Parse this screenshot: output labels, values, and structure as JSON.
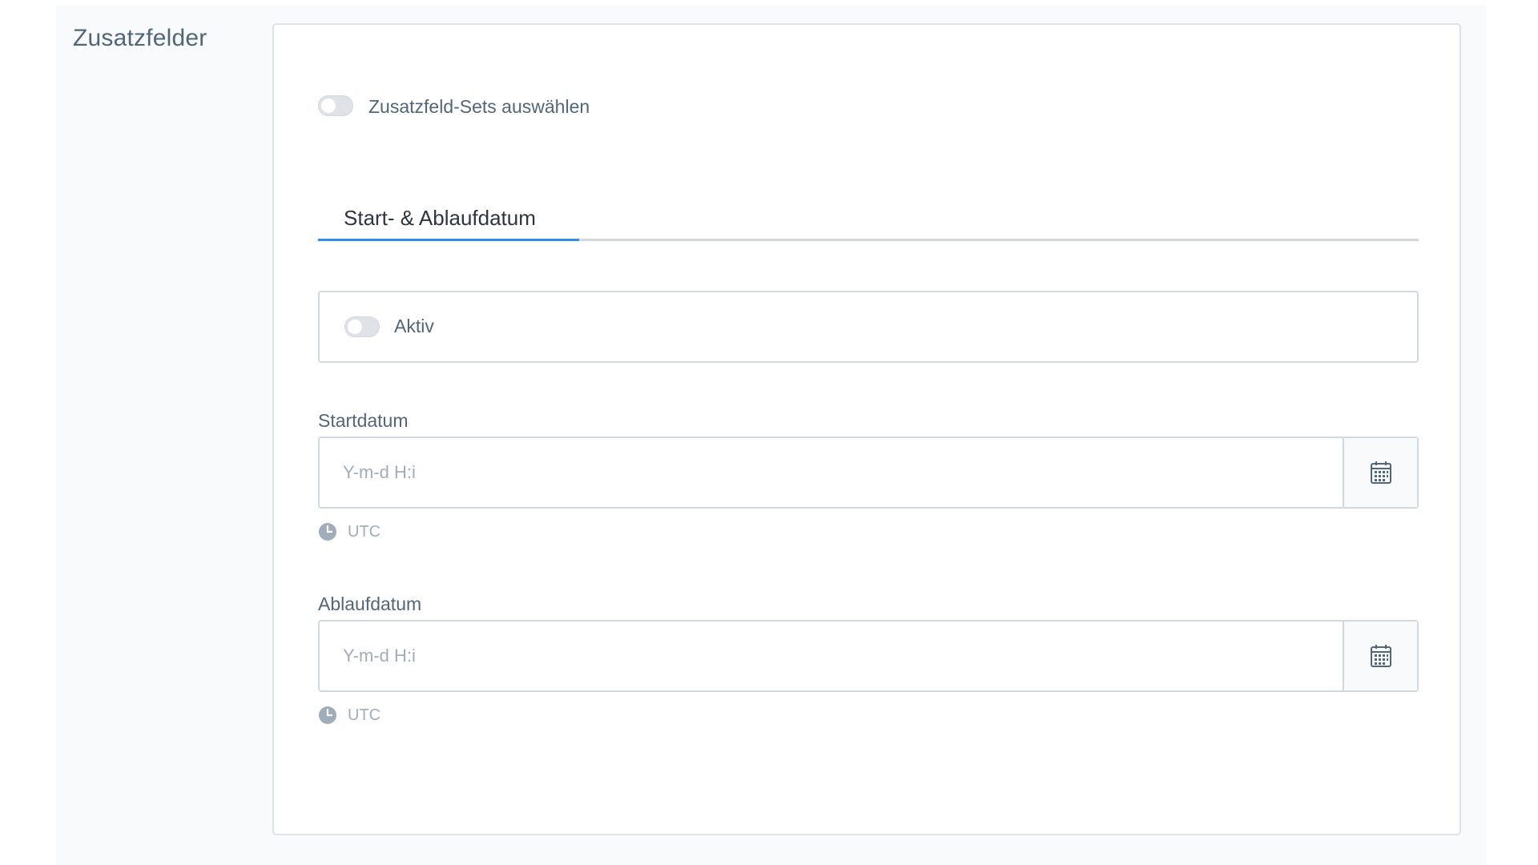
{
  "section": {
    "title": "Zusatzfelder"
  },
  "sets_toggle": {
    "label": "Zusatzfeld-Sets auswählen",
    "checked": false
  },
  "tabs": [
    {
      "label": "Start- & Ablaufdatum",
      "active": true
    }
  ],
  "active_toggle": {
    "label": "Aktiv",
    "checked": false
  },
  "start_date": {
    "label": "Startdatum",
    "placeholder": "Y-m-d H:i",
    "value": "",
    "timezone": "UTC"
  },
  "end_date": {
    "label": "Ablaufdatum",
    "placeholder": "Y-m-d H:i",
    "value": "",
    "timezone": "UTC"
  },
  "icons": {
    "calendar": "calendar-icon",
    "clock": "clock-icon"
  },
  "colors": {
    "accent": "#2f8fe6",
    "border": "#d1d9e0",
    "text": "#52667a",
    "muted": "#a0adba"
  }
}
